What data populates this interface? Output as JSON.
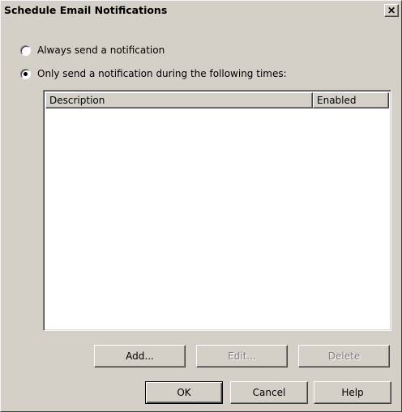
{
  "window": {
    "title": "Schedule Email Notifications",
    "close_glyph": "✕"
  },
  "options": [
    {
      "label": "Always send a notification",
      "selected": false
    },
    {
      "label": "Only send a notification during the following times:",
      "selected": true
    }
  ],
  "table": {
    "columns": [
      "Description",
      "Enabled"
    ],
    "rows": []
  },
  "buttons": {
    "add": "Add...",
    "edit": "Edit...",
    "delete": "Delete",
    "ok": "OK",
    "cancel": "Cancel",
    "help": "Help"
  },
  "icons": {
    "close": "close-icon"
  },
  "colors": {
    "dialog_bg": "#d4d0c8",
    "list_bg": "#ffffff",
    "disabled_text": "#808080"
  }
}
